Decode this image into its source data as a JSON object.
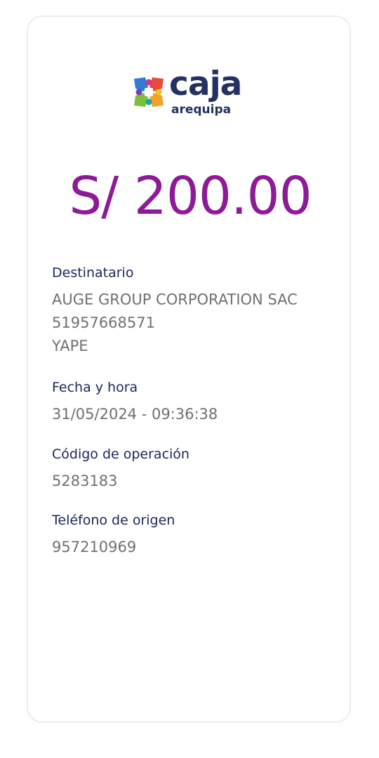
{
  "logo": {
    "name": "caja",
    "subname": "arequipa"
  },
  "amount": "S/ 200.00",
  "fields": [
    {
      "label": "Destinatario",
      "lines": [
        "AUGE GROUP CORPORATION SAC",
        "51957668571",
        "YAPE"
      ]
    },
    {
      "label": "Fecha y hora",
      "lines": [
        "31/05/2024 - 09:36:38"
      ]
    },
    {
      "label": "Código de operación",
      "lines": [
        "5283183"
      ]
    },
    {
      "label": "Teléfono de origen",
      "lines": [
        "957210969"
      ]
    }
  ],
  "colors": {
    "amount": "#8e1a97",
    "label": "#1b2759",
    "value": "#707070",
    "brand": "#233163"
  }
}
